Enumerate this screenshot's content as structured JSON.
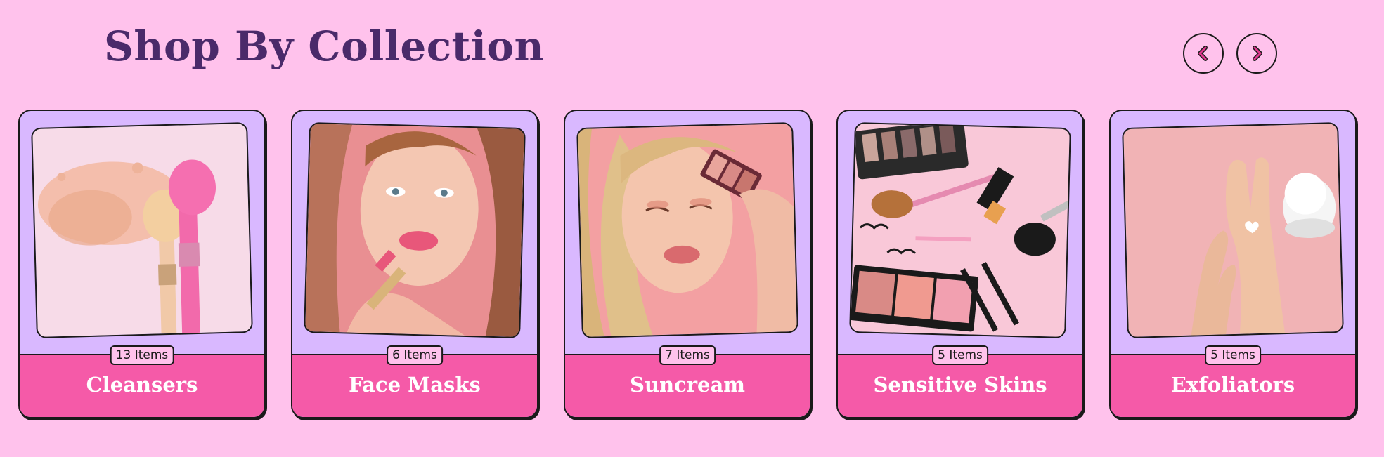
{
  "header": {
    "title": "Shop By Collection"
  },
  "nav": {
    "prev_icon": "chevron-left-icon",
    "next_icon": "chevron-right-icon"
  },
  "colors": {
    "page_background": "#ffc2ec",
    "title": "#4a2a6a",
    "card_background": "#d9b8ff",
    "card_footer": "#f55aa8",
    "chevron": "#e0368f"
  },
  "collections": [
    {
      "name": "Cleansers",
      "count": "13 Items",
      "image": "makeup-powder-and-brushes"
    },
    {
      "name": "Face Masks",
      "count": "6 Items",
      "image": "woman-applying-lipstick"
    },
    {
      "name": "Suncream",
      "count": "7 Items",
      "image": "woman-with-eyeshadow-palette"
    },
    {
      "name": "Sensitive Skins",
      "count": "5 Items",
      "image": "makeup-products-flatlay"
    },
    {
      "name": "Exfoliators",
      "count": "5 Items",
      "image": "hands-with-cream-jar"
    }
  ]
}
